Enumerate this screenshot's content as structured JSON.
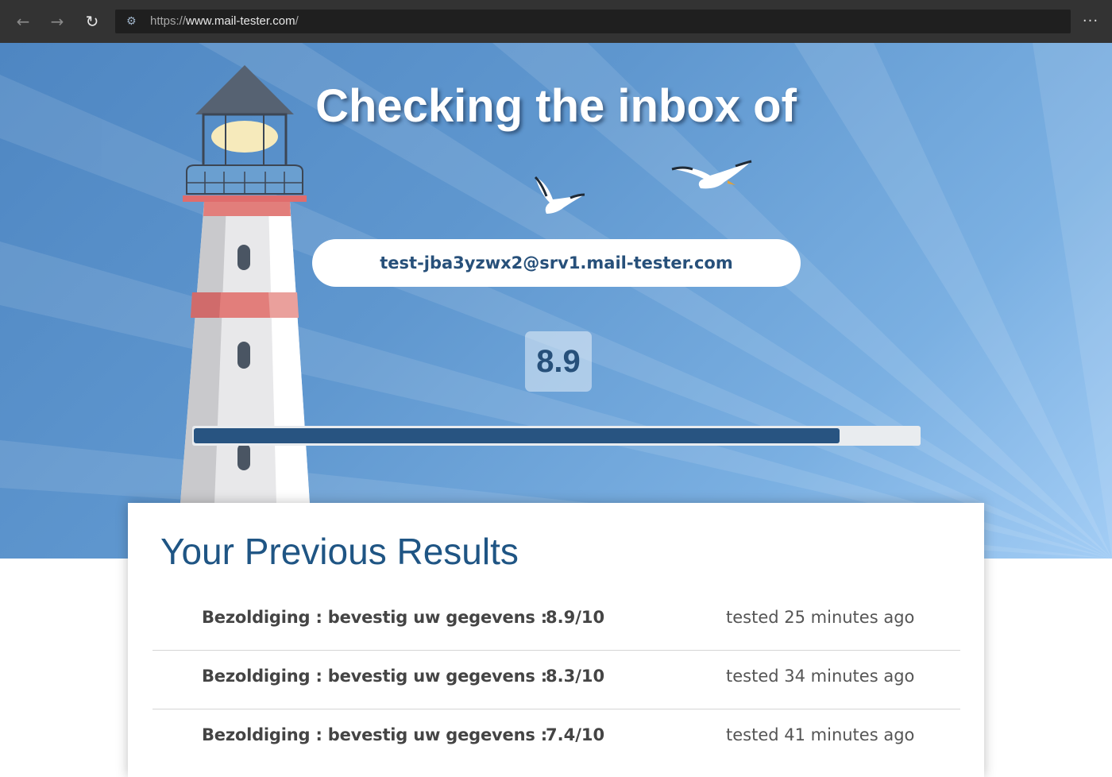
{
  "browser": {
    "back_icon": "arrow-left-icon",
    "forward_icon": "arrow-right-icon",
    "reload_icon": "reload-icon",
    "url_scheme": "https://",
    "url_host": "www.mail-tester.com",
    "url_path": "/",
    "more_label": "···"
  },
  "hero": {
    "title": "Checking the inbox of",
    "email": "test-jba3yzwx2@srv1.mail-tester.com",
    "score": "8.9",
    "progress_fraction": 0.89,
    "progress_color": "#285481",
    "background_color": "#5f97cf"
  },
  "results": {
    "title": "Your Previous Results",
    "items": [
      {
        "subject": "Bezoldiging : bevestig uw gegevens :",
        "score": "8.9/10",
        "time": "tested 25 minutes ago"
      },
      {
        "subject": "Bezoldiging : bevestig uw gegevens :",
        "score": "8.3/10",
        "time": "tested 34 minutes ago"
      },
      {
        "subject": "Bezoldiging : bevestig uw gegevens :",
        "score": "7.4/10",
        "time": "tested 41 minutes ago"
      }
    ]
  },
  "colors": {
    "accent": "#1f5584",
    "text": "#444444"
  }
}
